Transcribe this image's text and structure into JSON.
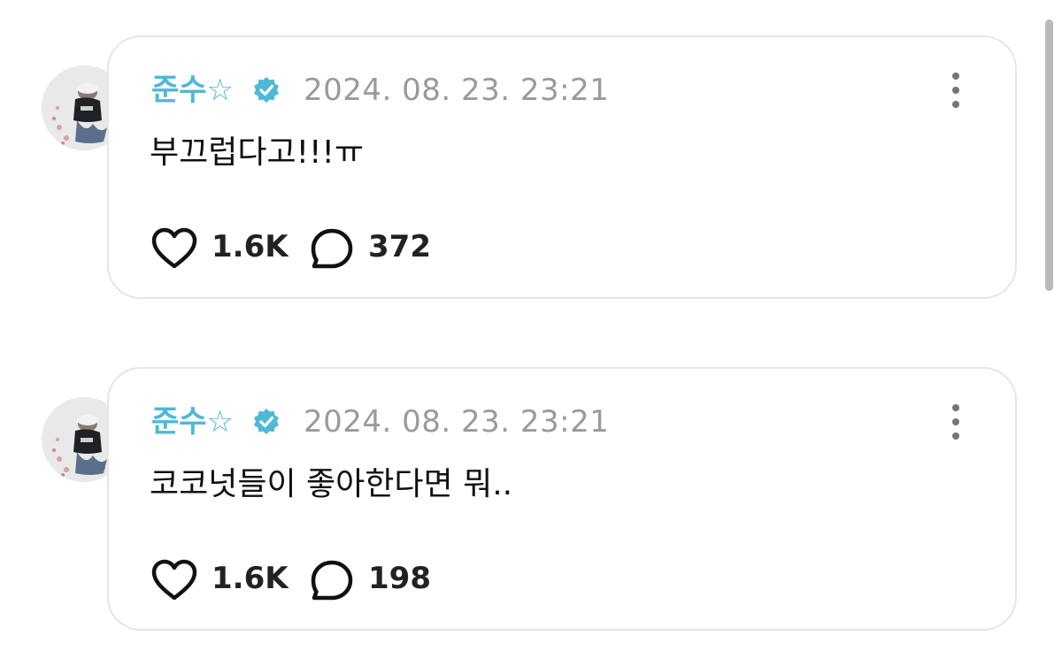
{
  "posts": [
    {
      "author": "준수☆",
      "timestamp": "2024. 08. 23. 23:21",
      "text": "부끄럽다고!!!ㅠ",
      "likes": "1.6K",
      "replies": "372"
    },
    {
      "author": "준수☆",
      "timestamp": "2024. 08. 23. 23:21",
      "text": "코코넛들이 좋아한다면 뭐..",
      "likes": "1.6K",
      "replies": "198"
    }
  ],
  "icons": {
    "verified": "verified-badge-icon",
    "more": "more-vertical-icon",
    "like": "heart-icon",
    "reply": "comment-bubble-icon"
  },
  "colors": {
    "author_name": "#4fb8d6",
    "timestamp": "#9a9a9a",
    "bubble_border": "#e6e6e6",
    "text": "#111111"
  }
}
